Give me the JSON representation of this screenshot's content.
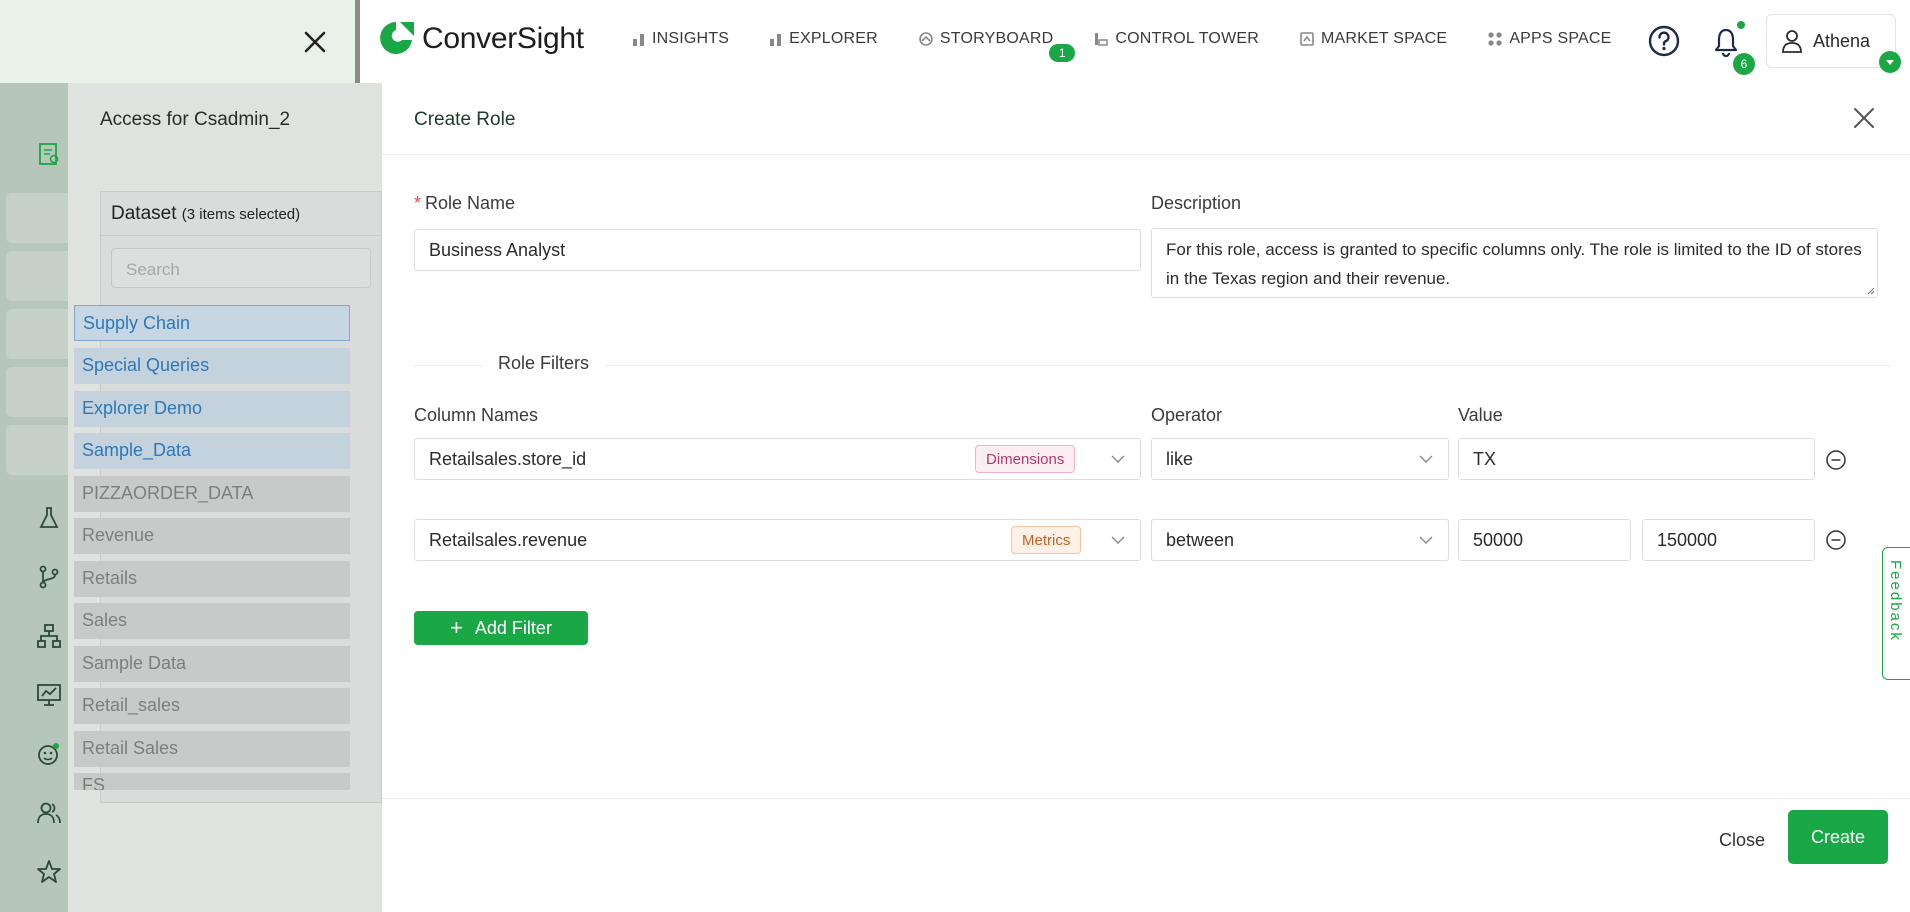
{
  "topbar": {
    "app_name": "ConverSight",
    "nav": [
      {
        "label": "INSIGHTS",
        "icon": "bar-chart-icon"
      },
      {
        "label": "EXPLORER",
        "icon": "bar-chart-icon"
      },
      {
        "label": "STORYBOARD",
        "icon": "storyboard-icon",
        "badge": "1"
      },
      {
        "label": "CONTROL TOWER",
        "icon": "control-tower-icon"
      },
      {
        "label": "MARKET SPACE",
        "icon": "market-icon"
      },
      {
        "label": "APPS SPACE",
        "icon": "apps-grid-icon"
      }
    ],
    "notifications_count": "6",
    "user_name": "Athena"
  },
  "background": {
    "panel_title": "Access for Csadmin_2",
    "dataset_header": "Dataset",
    "dataset_selected_count": "(3 items selected)",
    "search_placeholder": "Search",
    "datasets": [
      {
        "name": "Supply Chain",
        "selected": true
      },
      {
        "name": "Special Queries",
        "selected": true
      },
      {
        "name": "Explorer Demo",
        "selected": true
      },
      {
        "name": "Sample_Data",
        "selected": true
      },
      {
        "name": "PIZZAORDER_DATA",
        "selected": false
      },
      {
        "name": "Revenue",
        "selected": false
      },
      {
        "name": "Retails",
        "selected": false
      },
      {
        "name": "Sales",
        "selected": false
      },
      {
        "name": "Sample Data",
        "selected": false
      },
      {
        "name": "Retail_sales",
        "selected": false
      },
      {
        "name": "Retail Sales",
        "selected": false
      },
      {
        "name": "FS",
        "selected": false
      }
    ]
  },
  "modal": {
    "title": "Create Role",
    "role_name_label": "Role Name",
    "role_name_value": "Business Analyst",
    "description_label": "Description",
    "description_value": "For this role, access is granted to specific columns only. The role is limited to the ID of stores in the Texas region and their revenue.",
    "role_filters_label": "Role Filters",
    "col_names_label": "Column Names",
    "operator_label": "Operator",
    "value_label": "Value",
    "filters": [
      {
        "column": "Retailsales.store_id",
        "tag": "Dimensions",
        "operator": "like",
        "value": "TX",
        "value2": ""
      },
      {
        "column": "Retailsales.revenue",
        "tag": "Metrics",
        "operator": "between",
        "value": "50000",
        "value2": "150000"
      }
    ],
    "add_filter_label": "Add Filter",
    "close_label": "Close",
    "create_label": "Create"
  },
  "feedback_label": "Feedback",
  "colors": {
    "accent": "#1aa745",
    "dimension_tag": "#b23a6b",
    "metric_tag": "#c0622a"
  }
}
